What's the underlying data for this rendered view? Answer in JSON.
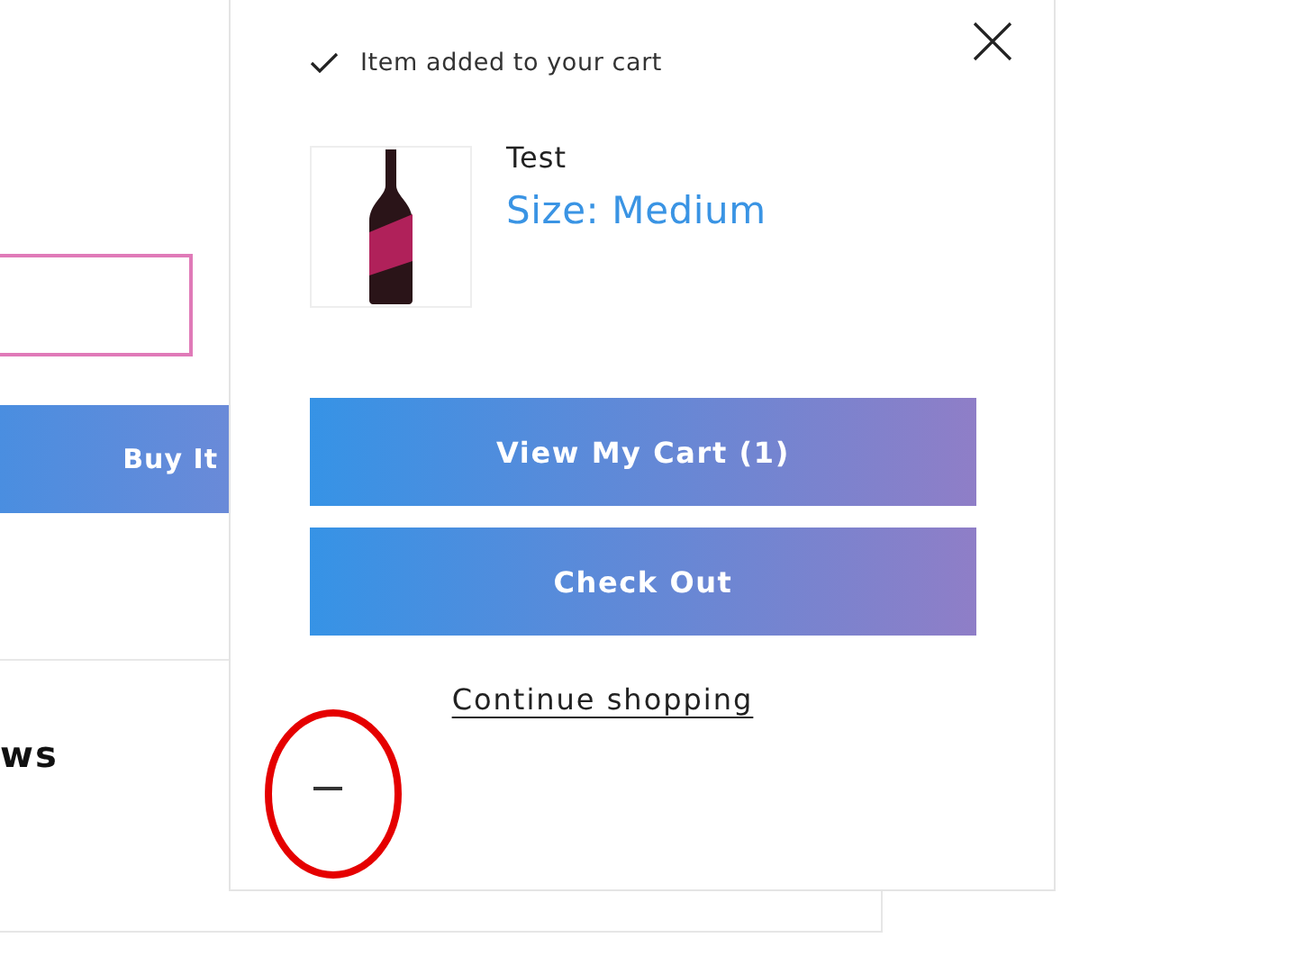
{
  "page": {
    "buy_button": "Buy It",
    "section_heading": "ws"
  },
  "cart_popup": {
    "notice": "Item added to your cart",
    "item": {
      "title": "Test",
      "variant": "Size: Medium"
    },
    "buttons": [
      "View My Cart (1)",
      "Check Out"
    ],
    "continue_link": "Continue shopping"
  }
}
